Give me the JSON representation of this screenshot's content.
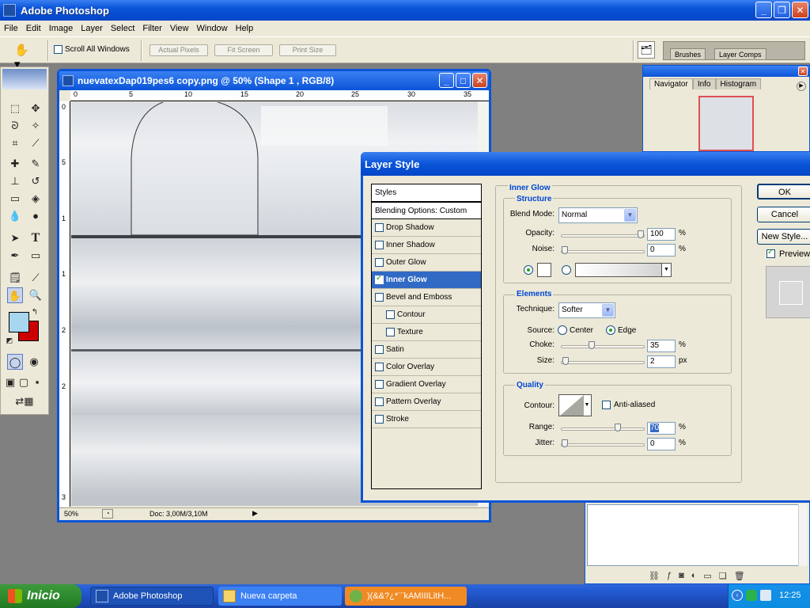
{
  "app": {
    "title": "Adobe Photoshop",
    "menu": [
      "File",
      "Edit",
      "Image",
      "Layer",
      "Select",
      "Filter",
      "View",
      "Window",
      "Help"
    ]
  },
  "options_bar": {
    "scroll_all_label": "Scroll All Windows",
    "actual_pixels": "Actual Pixels",
    "fit_screen": "Fit Screen",
    "print_size": "Print Size",
    "well_tabs": [
      "Brushes",
      "Layer Comps"
    ]
  },
  "document": {
    "title": "nuevatexDap019pes6 copy.png @ 50% (Shape 1 , RGB/8)",
    "zoom": "50%",
    "doc_size": "Doc: 3,00M/3,10M",
    "hruler_labels": [
      "0",
      "5",
      "10",
      "15",
      "20",
      "25",
      "30",
      "35"
    ],
    "vruler_labels": [
      "0",
      "5",
      "1",
      "1",
      "2",
      "2",
      "3"
    ]
  },
  "navigator": {
    "tabs": [
      "Navigator",
      "Info",
      "Histogram"
    ]
  },
  "layer_style": {
    "title": "Layer Style",
    "styles_header": "Styles",
    "blending": "Blending Options: Custom",
    "effects": [
      {
        "label": "Drop Shadow",
        "checked": false,
        "indent": false,
        "active": false
      },
      {
        "label": "Inner Shadow",
        "checked": false,
        "indent": false,
        "active": false
      },
      {
        "label": "Outer Glow",
        "checked": false,
        "indent": false,
        "active": false
      },
      {
        "label": "Inner Glow",
        "checked": true,
        "indent": false,
        "active": true
      },
      {
        "label": "Bevel and Emboss",
        "checked": false,
        "indent": false,
        "active": false
      },
      {
        "label": "Contour",
        "checked": false,
        "indent": true,
        "active": false
      },
      {
        "label": "Texture",
        "checked": false,
        "indent": true,
        "active": false
      },
      {
        "label": "Satin",
        "checked": false,
        "indent": false,
        "active": false
      },
      {
        "label": "Color Overlay",
        "checked": false,
        "indent": false,
        "active": false
      },
      {
        "label": "Gradient Overlay",
        "checked": false,
        "indent": false,
        "active": false
      },
      {
        "label": "Pattern Overlay",
        "checked": false,
        "indent": false,
        "active": false
      },
      {
        "label": "Stroke",
        "checked": false,
        "indent": false,
        "active": false
      }
    ],
    "panel_title": "Inner Glow",
    "structure": {
      "title": "Structure",
      "blend_mode_label": "Blend Mode:",
      "blend_mode": "Normal",
      "opacity_label": "Opacity:",
      "opacity": "100",
      "opacity_level": 1.0,
      "noise_label": "Noise:",
      "noise": "0",
      "noise_level": 0.0,
      "glow_color": "#ffffff"
    },
    "elements": {
      "title": "Elements",
      "technique_label": "Technique:",
      "technique": "Softer",
      "source_label": "Source:",
      "source_center": "Center",
      "source_edge": "Edge",
      "choke_label": "Choke:",
      "choke": "35",
      "choke_level": 0.35,
      "size_label": "Size:",
      "size": "2",
      "size_level": 0.01
    },
    "quality": {
      "title": "Quality",
      "contour_label": "Contour:",
      "anti_aliased": "Anti-aliased",
      "range_label": "Range:",
      "range": "70",
      "range_level": 0.7,
      "jitter_label": "Jitter:",
      "jitter": "0",
      "jitter_level": 0.0
    },
    "percent": "%",
    "px": "px",
    "buttons": {
      "ok": "OK",
      "cancel": "Cancel",
      "new_style": "New Style...",
      "preview": "Preview"
    }
  },
  "taskbar": {
    "start": "Inicio",
    "tasks": [
      "Adobe Photoshop",
      "Nueva carpeta",
      ")(&&?¿*¨¨kAMIIILitH..."
    ],
    "clock": "12:25"
  }
}
